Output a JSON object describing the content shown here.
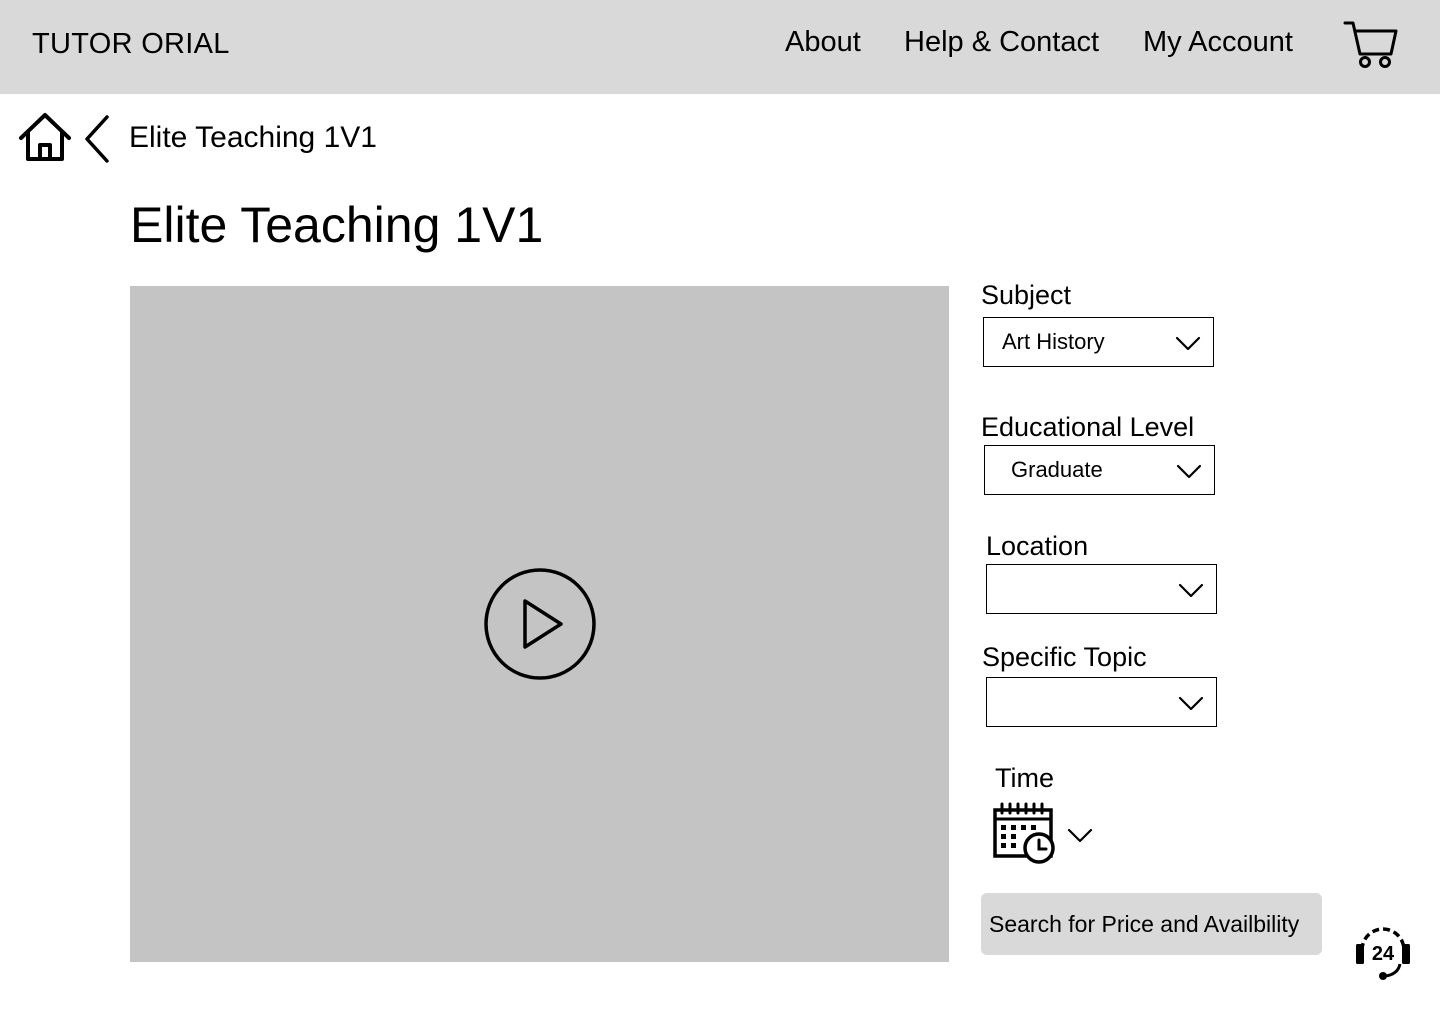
{
  "header": {
    "brand": "TUTOR ORIAL",
    "nav": {
      "about": "About",
      "help": "Help & Contact",
      "account": "My Account"
    },
    "cart_icon": "shopping-cart-icon"
  },
  "breadcrumb": {
    "home_icon": "home-icon",
    "back_icon": "chevron-left-icon",
    "current": "Elite Teaching 1V1"
  },
  "page": {
    "title": "Elite Teaching 1V1"
  },
  "video": {
    "play_icon": "play-icon",
    "placeholder_color": "#c4c4c4"
  },
  "form": {
    "subject": {
      "label": "Subject",
      "value": "Art History"
    },
    "level": {
      "label": "Educational Level",
      "value": "Graduate"
    },
    "location": {
      "label": "Location",
      "value": ""
    },
    "topic": {
      "label": "Specific Topic",
      "value": ""
    },
    "time": {
      "label": "Time",
      "icon": "calendar-clock-icon"
    },
    "search_button": "Search for Price and Availbility"
  },
  "support": {
    "icon": "support-24-icon",
    "badge": "24"
  },
  "colors": {
    "header_bg": "#d9d9d9",
    "button_bg": "#d9d9d9",
    "video_bg": "#c4c4c4"
  }
}
